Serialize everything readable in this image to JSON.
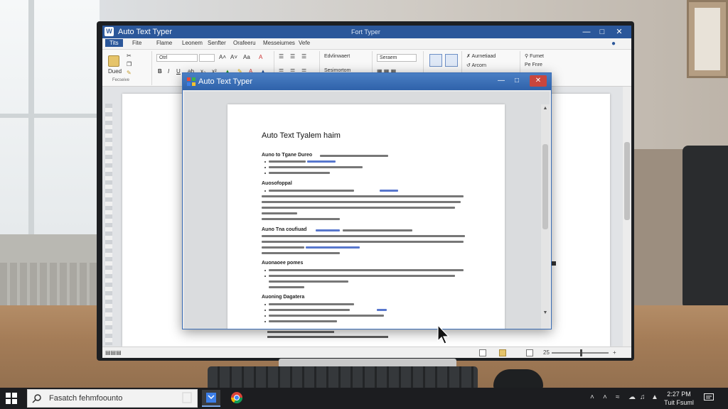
{
  "word": {
    "title": "Auto Text Typer",
    "title_center": "Fort Typer",
    "menu_tabs": [
      "Fite",
      "Flame",
      "Leonem",
      "Senfter",
      "Orafeeru",
      "Messeiumes",
      "Vefe"
    ],
    "active_tab": "Tits",
    "clipboard_label": "Fecseive",
    "paste_label": "Dued",
    "font_name": "Otrl",
    "styles_label": "Edvlinwaert",
    "styles_label_2": "Sesimortom",
    "style_box": "Seraem",
    "editing_1": "Aurnetiaad",
    "editing_2": "Arcorn",
    "find_label": "Fumet",
    "find_label_2": "Pe Fnre",
    "zoom_text": "25"
  },
  "dialog": {
    "title": "Auto Text Typer",
    "doc_title": "Auto Text Tyalem haim",
    "section_1": "Auno to Tgane Dureo",
    "section_2": "Auosofoppal",
    "section_3": "Auno Tna coufiuad",
    "section_4": "Auonaoee pomes",
    "section_5": "Auoning Dagatera"
  },
  "taskbar": {
    "search_text": "Fasatch fehmfoounto",
    "time": "2:27 PM",
    "date": "Tuit Fsuml"
  },
  "colors": {
    "word_blue": "#2b579a",
    "dialog_blue": "#2f62aa",
    "close_red": "#c9463d",
    "taskbar": "#1c1d20"
  }
}
